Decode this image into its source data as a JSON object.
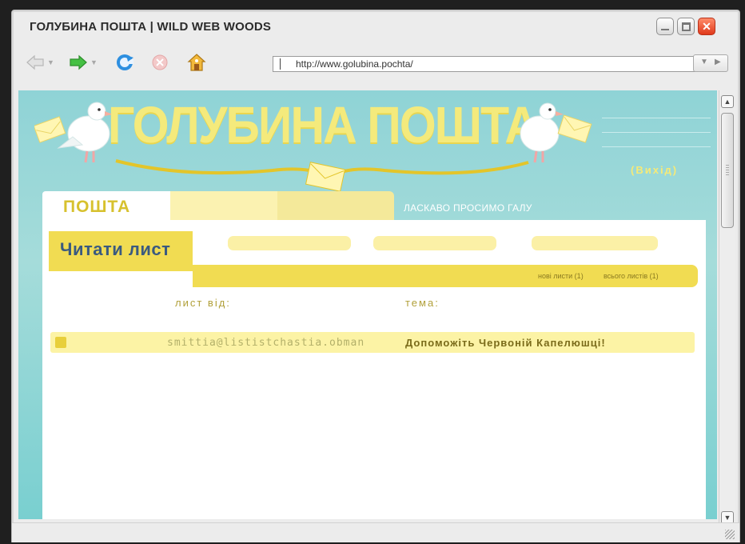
{
  "window": {
    "title": "ГОЛУБИНА ПОШТА | WILD WEB WOODS"
  },
  "toolbar": {
    "url": "http://www.golubina.pochta/"
  },
  "site": {
    "logo": "ГОЛУБИНА ПОШТА",
    "logout": "(Вихід)",
    "nav": {
      "mail_tab": "ПОШТА",
      "welcome": "ЛАСКАВО ПРОСИМО ГАЛУ"
    },
    "read_tab": "Читати лист",
    "counts": {
      "new": "нові листи (1)",
      "total": "всього листів (1)"
    },
    "columns": {
      "from": "лист від:",
      "subject": "тема:"
    },
    "messages": [
      {
        "from": "smittia@lististchastia.obman",
        "subject": "Допоможіть Червоній Капелюшці!"
      }
    ]
  },
  "colors": {
    "background": "#8fd3d6",
    "accent_yellow": "#f1dc52",
    "text_blue": "#3a5a80"
  }
}
